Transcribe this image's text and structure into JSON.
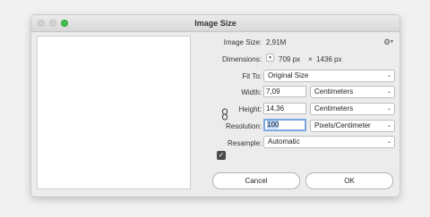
{
  "window": {
    "title": "Image Size"
  },
  "image_size": {
    "label": "Image Size:",
    "value": "2,91M"
  },
  "dimensions": {
    "label": "Dimensions:",
    "width": "709 px",
    "sep": "×",
    "height": "1436 px"
  },
  "fit_to": {
    "label": "Fit To:",
    "value": "Original Size"
  },
  "width": {
    "label": "Width:",
    "value": "7,09",
    "unit": "Centimeters"
  },
  "height": {
    "label": "Height:",
    "value": "14,36",
    "unit": "Centimeters"
  },
  "resolution": {
    "label": "Resolution:",
    "value": "100",
    "unit": "Pixels/Centimeter"
  },
  "resample": {
    "label": "Resample:",
    "checked": true,
    "value": "Automatic"
  },
  "buttons": {
    "cancel": "Cancel",
    "ok": "OK"
  },
  "icons": {
    "gear": "gear-icon",
    "link": "link-icon",
    "check": "checkmark-icon"
  }
}
